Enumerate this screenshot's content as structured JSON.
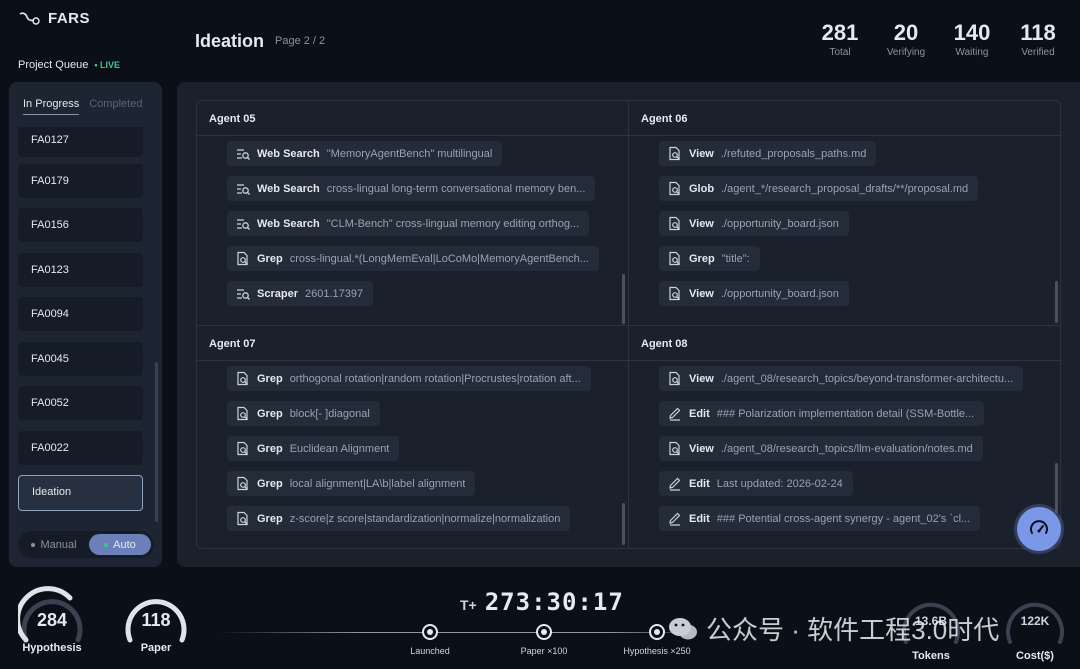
{
  "header": {
    "brand": "FARS",
    "queue_label": "Project Queue",
    "live_label": "• LIVE",
    "title": "Ideation",
    "page_info": "Page 2 / 2",
    "stats": [
      {
        "value": "281",
        "label": "Total"
      },
      {
        "value": "20",
        "label": "Verifying"
      },
      {
        "value": "140",
        "label": "Waiting"
      },
      {
        "value": "118",
        "label": "Verified"
      }
    ]
  },
  "sidebar": {
    "tabs": [
      "In Progress",
      "Completed"
    ],
    "items": [
      "FA0127",
      "FA0179",
      "FA0156",
      "FA0123",
      "FA0094",
      "FA0045",
      "FA0052",
      "FA0022",
      "Ideation"
    ],
    "mode_manual": "Manual",
    "mode_auto": "Auto"
  },
  "agents": [
    {
      "name": "Agent 05",
      "actions": [
        {
          "icon": "web-search-icon",
          "verb": "Web Search",
          "arg": "\"MemoryAgentBench\" multilingual"
        },
        {
          "icon": "web-search-icon",
          "verb": "Web Search",
          "arg": "cross-lingual long-term conversational memory ben..."
        },
        {
          "icon": "web-search-icon",
          "verb": "Web Search",
          "arg": "\"CLM-Bench\" cross-lingual memory editing orthog..."
        },
        {
          "icon": "grep-icon",
          "verb": "Grep",
          "arg": "cross-lingual.*(LongMemEval|LoCoMo|MemoryAgentBench..."
        },
        {
          "icon": "web-search-icon",
          "verb": "Scraper",
          "arg": "2601.17397"
        }
      ]
    },
    {
      "name": "Agent 06",
      "actions": [
        {
          "icon": "file-search-icon",
          "verb": "View",
          "arg": "./refuted_proposals_paths.md"
        },
        {
          "icon": "file-search-icon",
          "verb": "Glob",
          "arg": "./agent_*/research_proposal_drafts/**/proposal.md"
        },
        {
          "icon": "file-search-icon",
          "verb": "View",
          "arg": "./opportunity_board.json"
        },
        {
          "icon": "grep-icon",
          "verb": "Grep",
          "arg": "\"title\":"
        },
        {
          "icon": "file-search-icon",
          "verb": "View",
          "arg": "./opportunity_board.json"
        }
      ]
    },
    {
      "name": "Agent 07",
      "actions": [
        {
          "icon": "grep-icon",
          "verb": "Grep",
          "arg": "orthogonal rotation|random rotation|Procrustes|rotation aft..."
        },
        {
          "icon": "grep-icon",
          "verb": "Grep",
          "arg": "block[- ]diagonal"
        },
        {
          "icon": "grep-icon",
          "verb": "Grep",
          "arg": "Euclidean Alignment"
        },
        {
          "icon": "grep-icon",
          "verb": "Grep",
          "arg": "local alignment|LA\\b|label alignment"
        },
        {
          "icon": "grep-icon",
          "verb": "Grep",
          "arg": "z-score|z score|standardization|normalize|normalization"
        }
      ]
    },
    {
      "name": "Agent 08",
      "actions": [
        {
          "icon": "file-search-icon",
          "verb": "View",
          "arg": "./agent_08/research_topics/beyond-transformer-architectu..."
        },
        {
          "icon": "edit-icon",
          "verb": "Edit",
          "arg": "### Polarization implementation detail (SSM-Bottle..."
        },
        {
          "icon": "file-search-icon",
          "verb": "View",
          "arg": "./agent_08/research_topics/llm-evaluation/notes.md"
        },
        {
          "icon": "edit-icon",
          "verb": "Edit",
          "arg": "Last updated: 2026-02-24"
        },
        {
          "icon": "edit-icon",
          "verb": "Edit",
          "arg": "### Potential cross-agent synergy - agent_02's `cl..."
        }
      ]
    }
  ],
  "footer": {
    "hypothesis_value": "284",
    "hypothesis_label": "Hypothesis",
    "paper_value": "118",
    "paper_label": "Paper",
    "timer_prefix": "T+",
    "timer_value": "273:30:17",
    "milestones": [
      "Launched",
      "Paper ×100",
      "Hypothesis ×250"
    ],
    "tokens_value": "13.6B",
    "tokens_label": "Tokens",
    "cost_value": "122K",
    "cost_label": "Cost($)",
    "watermark": "公众号 · 软件工程3.0时代"
  },
  "colors": {
    "background": "#0b1018",
    "panel": "#1a212d",
    "live": "#3fc78a",
    "accent": "#7b97e8",
    "auto_toggle": "#6b7fb8"
  }
}
